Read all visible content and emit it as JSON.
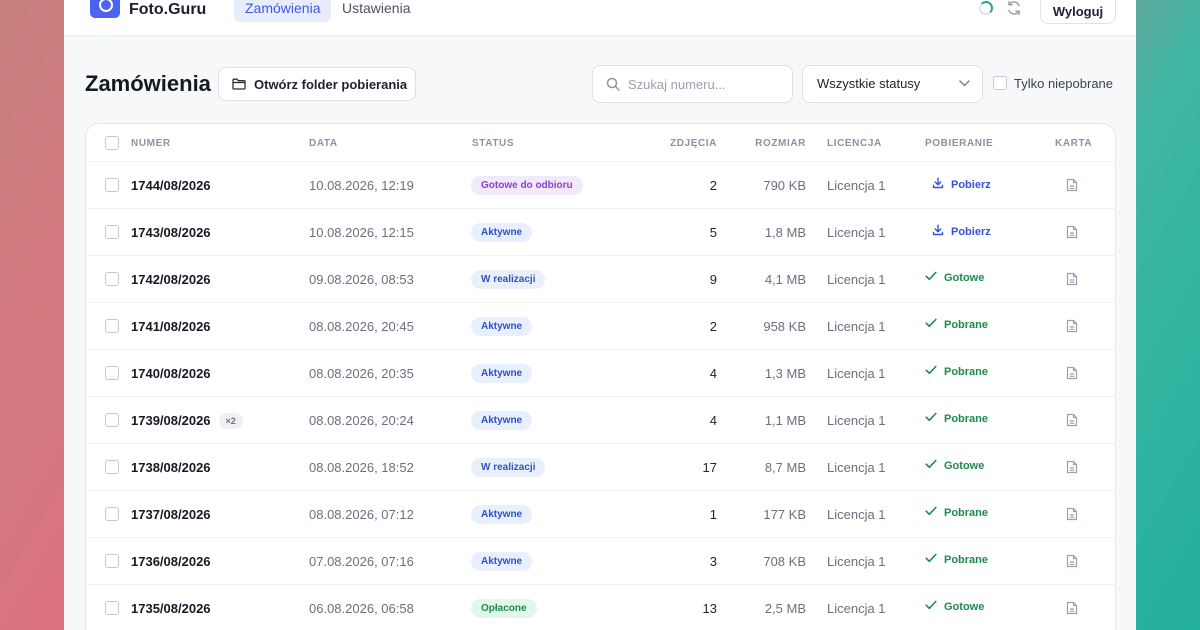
{
  "app": {
    "name": "Foto.Guru",
    "nav": [
      {
        "label": "Zamówienia",
        "active": true
      },
      {
        "label": "Ustawienia",
        "active": false
      }
    ],
    "logout_label": "Wyloguj",
    "accent": "#4b63f0"
  },
  "page": {
    "title": "Zamówienia",
    "open_folder_label": "Otwórz folder pobierania",
    "search_placeholder": "Szukaj numeru...",
    "status_filter_value": "Wszystkie statusy",
    "only_not_downloaded_label": "Tylko niepobrane"
  },
  "table": {
    "columns": [
      "NUMER",
      "DATA",
      "STATUS",
      "ZDJĘCIA",
      "ROZMIAR",
      "LICENCJA",
      "POBIERANIE",
      "KARTA"
    ],
    "rows": [
      {
        "number": "1744/08/2026",
        "extra": "",
        "date": "10.08.2026, 12:19",
        "status": "Gotowe do odbioru",
        "status_kind": "ready",
        "photos": "2",
        "size": "790 KB",
        "license": "Licencja 1",
        "download": "Pobierz",
        "download_kind": "get"
      },
      {
        "number": "1743/08/2026",
        "extra": "",
        "date": "10.08.2026, 12:15",
        "status": "Aktywne",
        "status_kind": "active",
        "photos": "5",
        "size": "1,8 MB",
        "license": "Licencja 1",
        "download": "Pobierz",
        "download_kind": "get"
      },
      {
        "number": "1742/08/2026",
        "extra": "",
        "date": "09.08.2026, 08:53",
        "status": "W realizacji",
        "status_kind": "prog",
        "photos": "9",
        "size": "4,1 MB",
        "license": "Licencja 1",
        "download": "Gotowe",
        "download_kind": "done"
      },
      {
        "number": "1741/08/2026",
        "extra": "",
        "date": "08.08.2026, 20:45",
        "status": "Aktywne",
        "status_kind": "active",
        "photos": "2",
        "size": "958 KB",
        "license": "Licencja 1",
        "download": "Pobrane",
        "download_kind": "done"
      },
      {
        "number": "1740/08/2026",
        "extra": "",
        "date": "08.08.2026, 20:35",
        "status": "Aktywne",
        "status_kind": "active",
        "photos": "4",
        "size": "1,3 MB",
        "license": "Licencja 1",
        "download": "Pobrane",
        "download_kind": "done"
      },
      {
        "number": "1739/08/2026",
        "extra": "×2",
        "date": "08.08.2026, 20:24",
        "status": "Aktywne",
        "status_kind": "active",
        "photos": "4",
        "size": "1,1 MB",
        "license": "Licencja 1",
        "download": "Pobrane",
        "download_kind": "done"
      },
      {
        "number": "1738/08/2026",
        "extra": "",
        "date": "08.08.2026, 18:52",
        "status": "W realizacji",
        "status_kind": "prog",
        "photos": "17",
        "size": "8,7 MB",
        "license": "Licencja 1",
        "download": "Gotowe",
        "download_kind": "done"
      },
      {
        "number": "1737/08/2026",
        "extra": "",
        "date": "08.08.2026, 07:12",
        "status": "Aktywne",
        "status_kind": "active",
        "photos": "1",
        "size": "177 KB",
        "license": "Licencja 1",
        "download": "Pobrane",
        "download_kind": "done"
      },
      {
        "number": "1736/08/2026",
        "extra": "",
        "date": "07.08.2026, 07:16",
        "status": "Aktywne",
        "status_kind": "active",
        "photos": "3",
        "size": "708 KB",
        "license": "Licencja 1",
        "download": "Pobrane",
        "download_kind": "done"
      },
      {
        "number": "1735/08/2026",
        "extra": "",
        "date": "06.08.2026, 06:58",
        "status": "Opłacone",
        "status_kind": "paid",
        "photos": "13",
        "size": "2,5 MB",
        "license": "Licencja 1",
        "download": "Gotowe",
        "download_kind": "done"
      }
    ]
  }
}
